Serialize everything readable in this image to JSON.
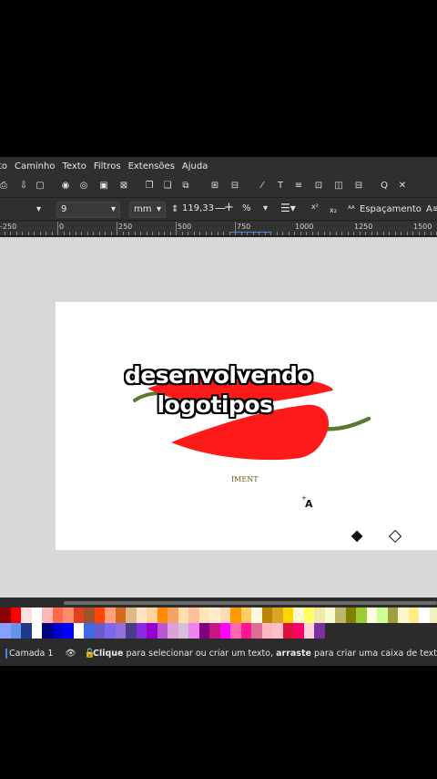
{
  "menu": [
    "to",
    "Caminho",
    "Texto",
    "Filtros",
    "Extensões",
    "Ajuda"
  ],
  "controls": {
    "font_size": "9",
    "unit": "mm",
    "spacing_value": "119,33",
    "percent_unit": "%",
    "spacing_label": "Espaçamento"
  },
  "ruler_labels": [
    "-250",
    "0",
    "250",
    "500",
    "750",
    "1000",
    "1250",
    "1500"
  ],
  "canvas_overlay": {
    "line1": "desenvolvendo",
    "line2": "logotipos"
  },
  "small_logo_text": "IMENT",
  "cursor_letter": "A",
  "status": {
    "layer": "Camada 1",
    "click_word": "Clique",
    "msg1": " para selecionar ou criar um texto, ",
    "drag_word": "arraste",
    "msg2": " para criar uma caixa de texto de pa"
  },
  "colors": {
    "pepper": "#ff1a1a",
    "stem": "#5a7a2e",
    "ui_bg": "#2b2b2b",
    "accent": "#4a86e8"
  },
  "palette_row1": [
    "#8b0000",
    "#ff0000",
    "#ffe0e0",
    "#ffffff",
    "#ffb6b6",
    "#ff6a4d",
    "#ff8c69",
    "#e04020",
    "#a0522d",
    "#ff4500",
    "#ffa07a",
    "#d2691e",
    "#deb887",
    "#ffe4c4",
    "#ffd39b",
    "#ff8c00",
    "#f4a460",
    "#ffdead",
    "#ffc0a0",
    "#ffe4b5",
    "#ffebcd",
    "#ffdab9",
    "#ff9900",
    "#ffcc66",
    "#fff8dc",
    "#b8860b",
    "#daa520",
    "#ffd700",
    "#fffacd",
    "#ffff66",
    "#eee8aa",
    "#fafad2",
    "#bdb76b",
    "#808000",
    "#9acd32",
    "#ffffe0",
    "#ccff99",
    "#a0a040",
    "#fff5cc",
    "#ffee88",
    "#ffffff",
    "#f0f0c0"
  ],
  "palette_row2": [
    "#87a0ff",
    "#6495ed",
    "#1e3a8a",
    "#ffffff",
    "#000080",
    "#0000cd",
    "#0000ff",
    "#ffffff",
    "#4169e1",
    "#6a5acd",
    "#7b68ee",
    "#9370db",
    "#483d8b",
    "#8a2be2",
    "#9400d3",
    "#ba55d3",
    "#dda0dd",
    "#d8bfd8",
    "#ee82ee",
    "#800080",
    "#c71585",
    "#ff00ff",
    "#ff69b4",
    "#ff1493",
    "#db7093",
    "#ffb6c1",
    "#ffc0cb",
    "#dc143c",
    "#ff0066",
    "#ffd0e0",
    "#7b2fa0",
    "#2b2b2b"
  ]
}
